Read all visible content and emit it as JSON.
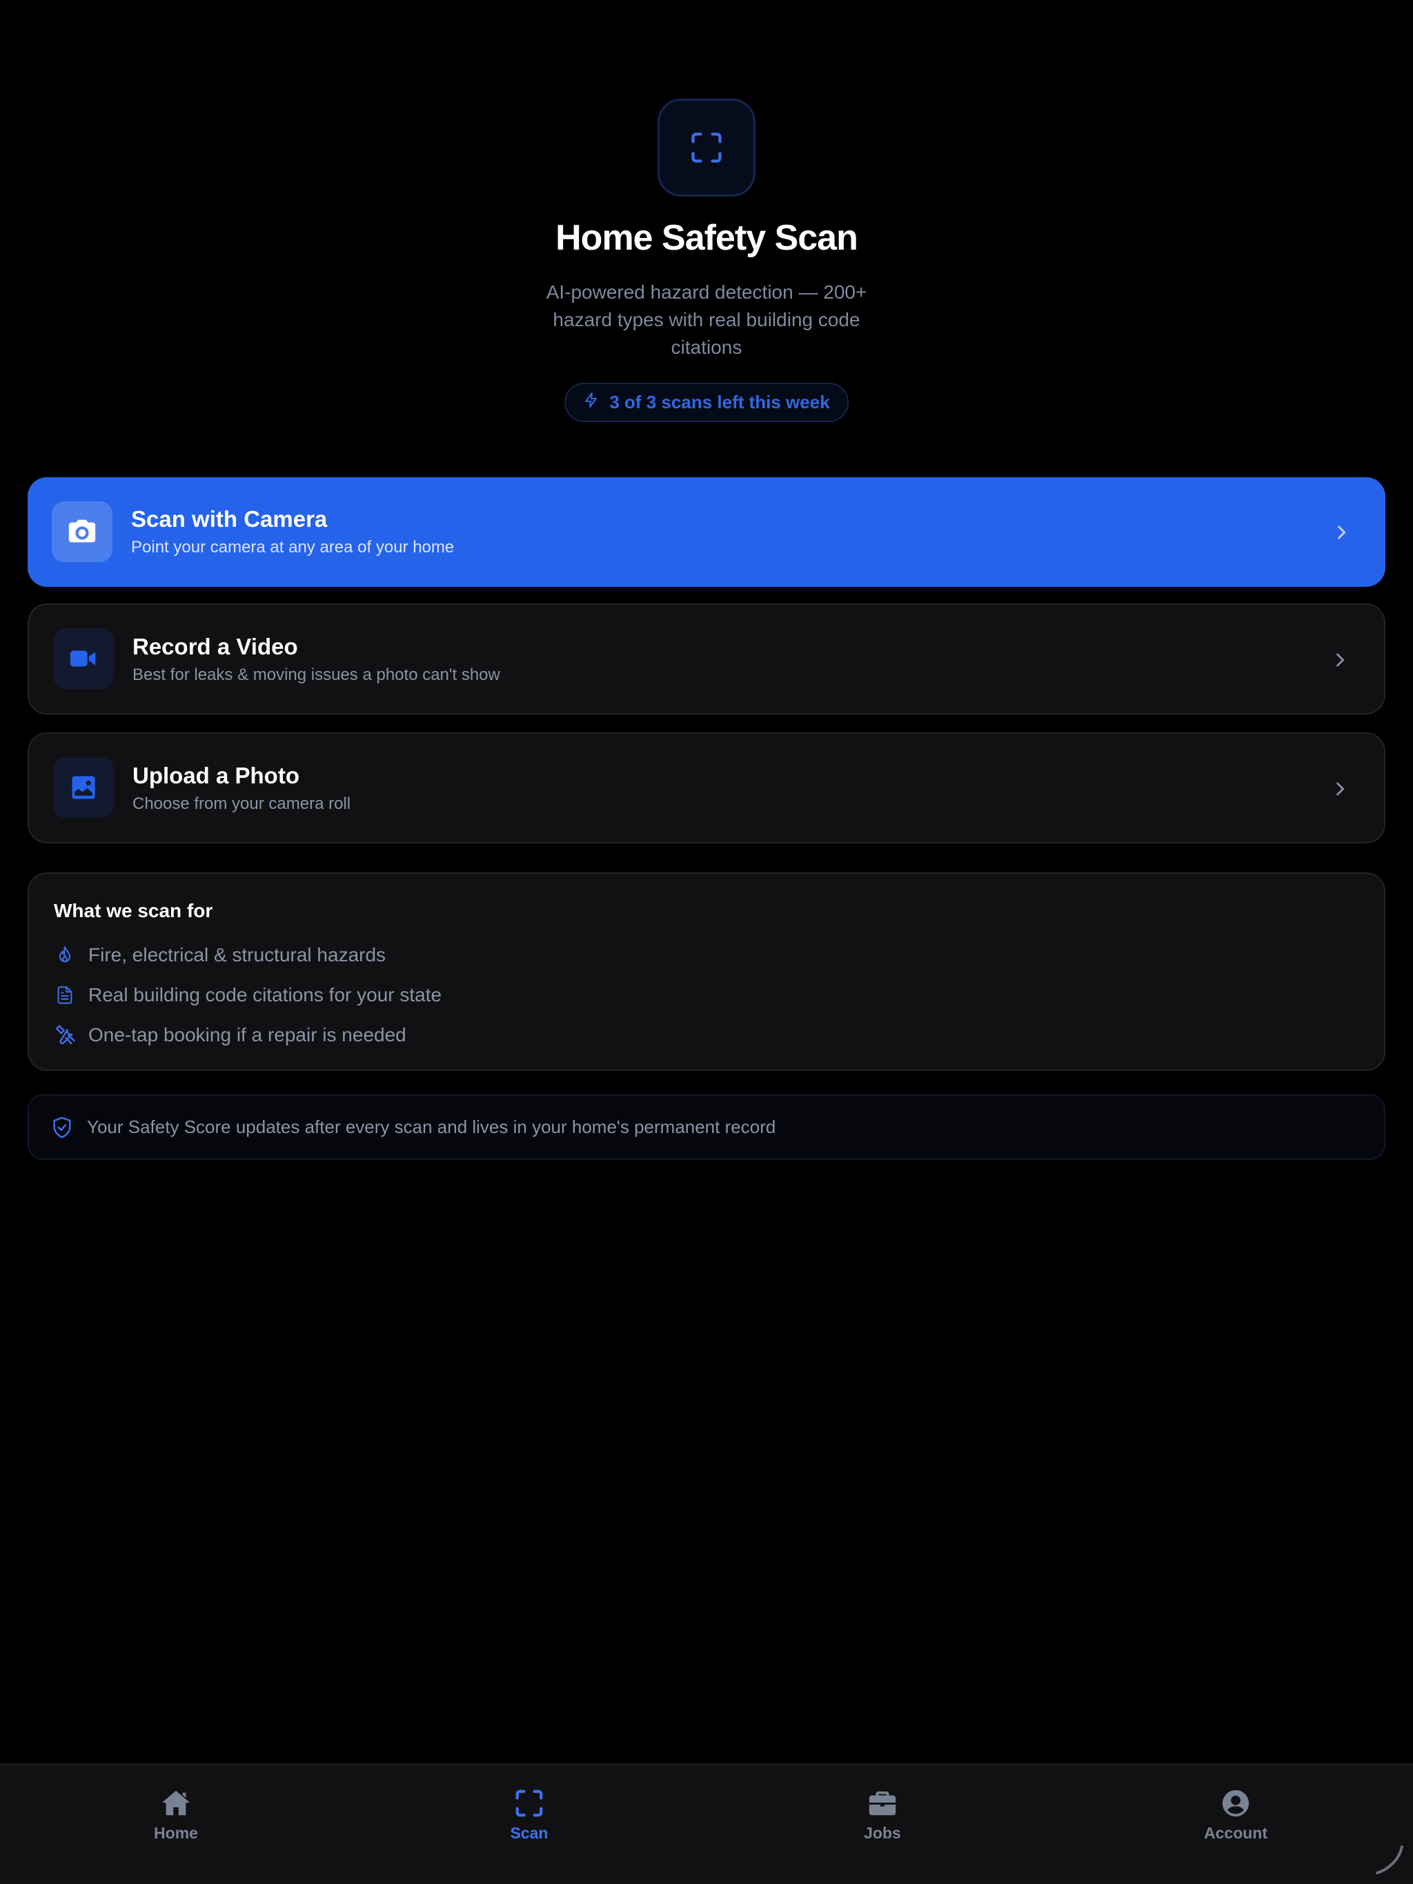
{
  "hero": {
    "title": "Home Safety Scan",
    "subtitle": "AI-powered hazard detection — 200+ hazard types with real building code citations",
    "quota_badge": "3 of 3 scans left this week",
    "icon": "scan-frame-icon"
  },
  "actions": [
    {
      "title": "Scan with Camera",
      "subtitle": "Point your camera at any area of your home",
      "icon": "camera-icon"
    },
    {
      "title": "Record a Video",
      "subtitle": "Best for leaks & moving issues a photo can't show",
      "icon": "video-camera-icon"
    },
    {
      "title": "Upload a Photo",
      "subtitle": "Choose from your camera roll",
      "icon": "photo-icon"
    }
  ],
  "features": {
    "title": "What we scan for",
    "items": [
      {
        "text": "Fire, electrical & structural hazards",
        "icon": "flame-icon"
      },
      {
        "text": "Real building code citations for your state",
        "icon": "document-icon"
      },
      {
        "text": "One-tap booking if a repair is needed",
        "icon": "tools-icon"
      }
    ]
  },
  "note": {
    "text": "Your Safety Score updates after every scan and lives in your home's permanent record",
    "icon": "shield-check-icon"
  },
  "tabbar": {
    "items": [
      {
        "label": "Home",
        "icon": "home-icon",
        "active": false
      },
      {
        "label": "Scan",
        "icon": "scan-frame-icon",
        "active": true
      },
      {
        "label": "Jobs",
        "icon": "briefcase-icon",
        "active": false
      },
      {
        "label": "Account",
        "icon": "user-circle-icon",
        "active": false
      }
    ]
  },
  "colors": {
    "accent": "#2563eb",
    "background": "#000000",
    "card": "#111113",
    "muted_text": "#8b94a6",
    "active_tab": "#3b74f0"
  }
}
